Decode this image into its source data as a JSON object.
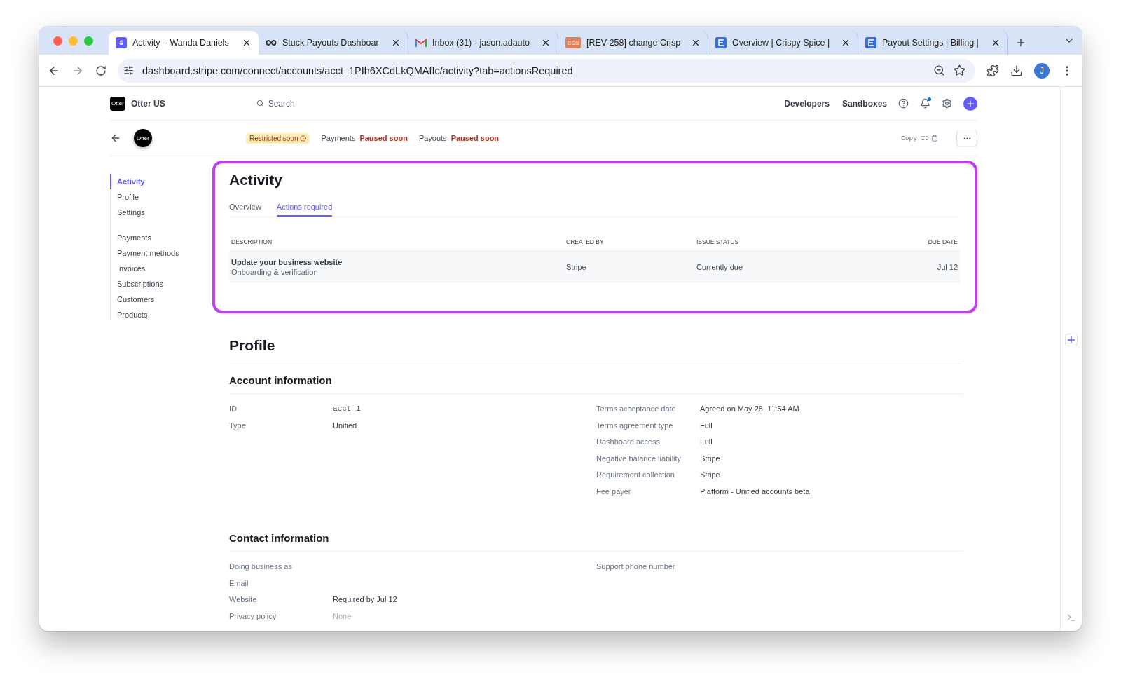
{
  "browser": {
    "tabs": [
      {
        "title": "Activity – Wanda Daniels",
        "kind": "stripe",
        "selected": true
      },
      {
        "title": "Stuck Payouts Dashboar",
        "kind": "infinity",
        "selected": false
      },
      {
        "title": "Inbox (31) - jason.adauto",
        "kind": "mail",
        "selected": false
      },
      {
        "title": "[REV-258] change Crisp",
        "kind": "css",
        "selected": false
      },
      {
        "title": "Overview | Crispy Spice |",
        "kind": "panel",
        "selected": false
      },
      {
        "title": "Payout Settings | Billing |",
        "kind": "panel",
        "selected": false
      }
    ],
    "css_label": "CSS",
    "url": "dashboard.stripe.com/connect/accounts/acct_1PIh6XCdLkQMAfIc/activity?tab=actionsRequired",
    "avatar": "J"
  },
  "header": {
    "logo": "Otter",
    "account": "Otter US",
    "search_placeholder": "Search",
    "links": [
      "Developers",
      "Sandboxes"
    ]
  },
  "account_bar": {
    "avatar": "Otter",
    "badge": "Restricted soon",
    "statuses": [
      {
        "label": "Payments",
        "value": "Paused soon"
      },
      {
        "label": "Payouts",
        "value": "Paused soon"
      }
    ],
    "copy": "Copy ID"
  },
  "sidebar": {
    "groups": [
      [
        {
          "label": "Activity",
          "selected": true
        },
        {
          "label": "Profile",
          "selected": false
        },
        {
          "label": "Settings",
          "selected": false
        }
      ],
      [
        {
          "label": "Payments",
          "selected": false
        },
        {
          "label": "Payment methods",
          "selected": false
        },
        {
          "label": "Invoices",
          "selected": false
        },
        {
          "label": "Subscriptions",
          "selected": false
        },
        {
          "label": "Customers",
          "selected": false
        },
        {
          "label": "Products",
          "selected": false
        }
      ]
    ]
  },
  "activity": {
    "title": "Activity",
    "tabs": [
      {
        "label": "Overview",
        "selected": false
      },
      {
        "label": "Actions required",
        "selected": true
      }
    ],
    "columns": [
      "DESCRIPTION",
      "CREATED BY",
      "ISSUE STATUS",
      "DUE DATE"
    ],
    "rows": [
      {
        "title": "Update your business website",
        "subtitle": "Onboarding & verification",
        "created_by": "Stripe",
        "status": "Currently due",
        "due": "Jul 12"
      }
    ]
  },
  "profile": {
    "title": "Profile",
    "sections": [
      {
        "title": "Account information",
        "left": [
          {
            "label": "ID",
            "value": "acct_1",
            "mono": true,
            "muted": false
          },
          {
            "label": "Type",
            "value": "Unified",
            "mono": false,
            "muted": false
          }
        ],
        "right": [
          {
            "label": "Terms acceptance date",
            "value": "Agreed on May 28, 11:54 AM",
            "mono": false,
            "muted": false
          },
          {
            "label": "Terms agreement type",
            "value": "Full",
            "mono": false,
            "muted": false
          },
          {
            "label": "Dashboard access",
            "value": "Full",
            "mono": false,
            "muted": false
          },
          {
            "label": "Negative balance liability",
            "value": "Stripe",
            "mono": false,
            "muted": false
          },
          {
            "label": "Requirement collection",
            "value": "Stripe",
            "mono": false,
            "muted": false
          },
          {
            "label": "Fee payer",
            "value": "Platform - Unified accounts beta",
            "mono": false,
            "muted": false
          }
        ]
      },
      {
        "title": "Contact information",
        "left": [
          {
            "label": "Doing business as"
          },
          {
            "label": "Email"
          },
          {
            "label": "Website",
            "value": "Required by Jul 12",
            "mono": false,
            "muted": false
          },
          {
            "label": "Privacy policy",
            "value": "None",
            "mono": false,
            "muted": true
          }
        ],
        "right": [
          {
            "label": "Support phone number"
          }
        ]
      }
    ]
  }
}
